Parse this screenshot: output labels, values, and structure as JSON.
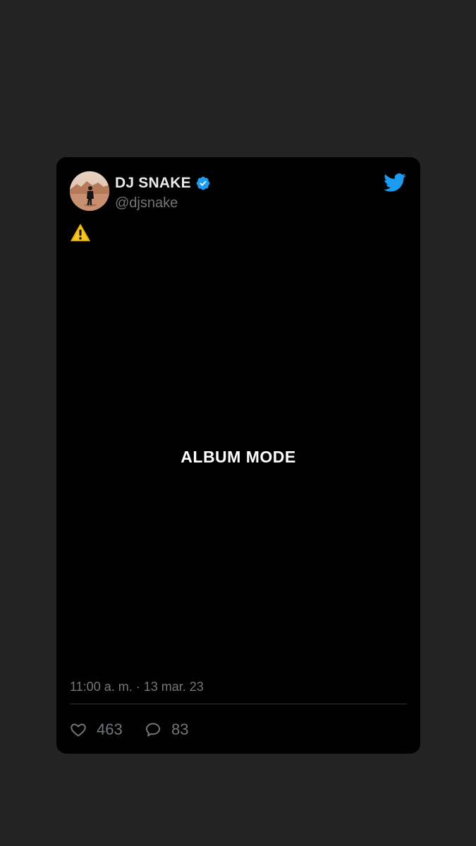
{
  "tweet": {
    "display_name": "DJ SNAKE",
    "handle": "@djsnake",
    "verified": true,
    "body_icon": "warning-icon",
    "media_text": "ALBUM MODE",
    "timestamp": "11:00 a. m. · 13 mar. 23",
    "likes": "463",
    "replies": "83"
  },
  "colors": {
    "page_background": "#232323",
    "card_background": "#000000",
    "twitter_blue": "#1d9bf0",
    "secondary_text": "#71767b",
    "primary_text": "#e7e9ea"
  },
  "icons": {
    "brand": "twitter-bird-icon",
    "verified": "verified-badge-icon",
    "like": "heart-icon",
    "reply": "reply-bubble-icon"
  }
}
